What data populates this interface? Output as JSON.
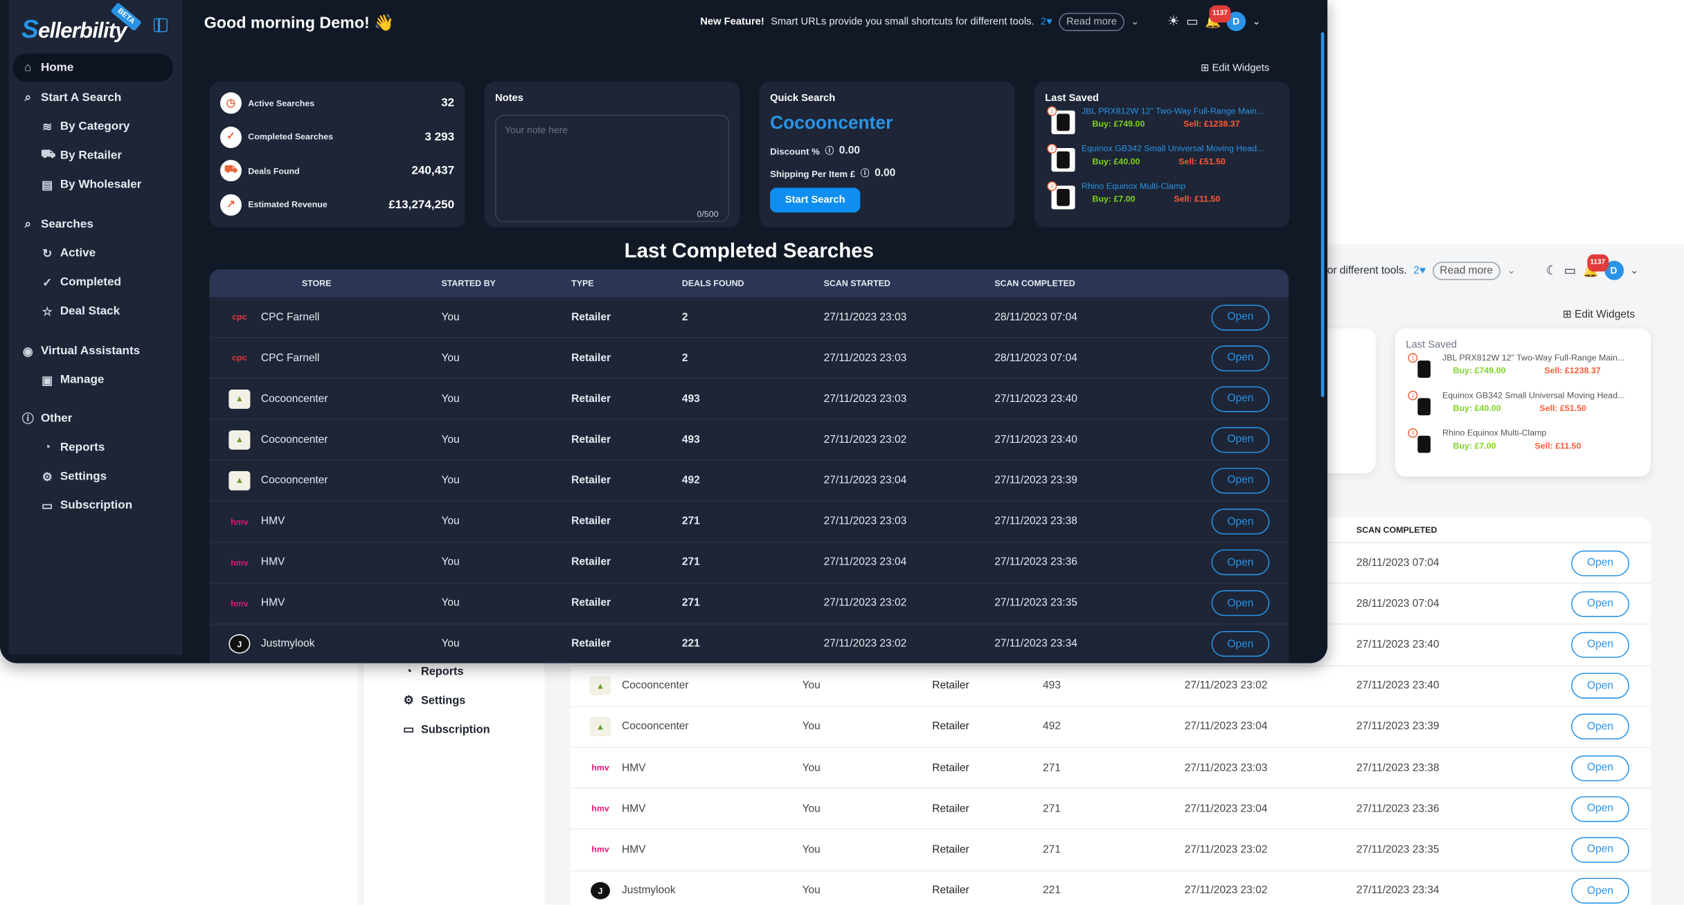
{
  "app": {
    "logo": "ellerbility",
    "logo_first": "S",
    "beta": "BETA",
    "greeting": "Good morning Demo! 👋"
  },
  "topbar": {
    "feature_bold": "New Feature!",
    "feature_text": "Smart URLs provide you small shortcuts for different tools.",
    "feature_text_partial": "for different tools.",
    "likes": "2",
    "read_more": "Read more",
    "notif_count": "1137",
    "avatar": "D"
  },
  "edit_widgets": "Edit Widgets",
  "sidebar": {
    "items": [
      {
        "label": "Home",
        "icon": "home-icon"
      },
      {
        "label": "Start A Search",
        "icon": "search-icon"
      },
      {
        "label": "By Category",
        "icon": "layers-icon"
      },
      {
        "label": "By Retailer",
        "icon": "cart-icon"
      },
      {
        "label": "By Wholesaler",
        "icon": "document-icon"
      },
      {
        "label": "Searches",
        "icon": "search-icon"
      },
      {
        "label": "Active",
        "icon": "refresh-icon"
      },
      {
        "label": "Completed",
        "icon": "check-circle-icon"
      },
      {
        "label": "Deal Stack",
        "icon": "star-icon"
      },
      {
        "label": "Virtual Assistants",
        "icon": "user-circle-icon"
      },
      {
        "label": "Manage",
        "icon": "manage-icon"
      },
      {
        "label": "Other",
        "icon": "info-icon"
      },
      {
        "label": "Reports",
        "icon": "pie-icon"
      },
      {
        "label": "Settings",
        "icon": "gear-icon"
      },
      {
        "label": "Subscription",
        "icon": "card-icon"
      }
    ]
  },
  "stats": [
    {
      "label": "Active Searches",
      "value": "32"
    },
    {
      "label": "Completed Searches",
      "value": "3 293"
    },
    {
      "label": "Deals Found",
      "value": "240,437"
    },
    {
      "label": "Estimated Revenue",
      "value": "£13,274,250"
    }
  ],
  "notes": {
    "title": "Notes",
    "placeholder": "Your note here",
    "count": "0/500"
  },
  "quick_search": {
    "title": "Quick Search",
    "store": "Cocooncenter",
    "discount_label": "Discount %",
    "discount_value": "0.00",
    "shipping_label": "Shipping Per Item £",
    "shipping_value": "0.00",
    "button": "Start Search"
  },
  "last_saved": {
    "title": "Last Saved",
    "items": [
      {
        "title": "JBL PRX812W 12\" Two-Way Full-Range Main...",
        "buy": "Buy: £749.00",
        "sell": "Sell: £1238.37"
      },
      {
        "title": "Equinox GB342 Small Universal Moving Head...",
        "buy": "Buy: £40.00",
        "sell": "Sell: £51.50"
      },
      {
        "title": "Rhino Equinox Multi-Clamp",
        "buy": "Buy: £7.00",
        "sell": "Sell: £11.50"
      }
    ]
  },
  "table": {
    "title": "Last Completed Searches",
    "headers": [
      "STORE",
      "STARTED BY",
      "TYPE",
      "DEALS FOUND",
      "SCAN STARTED",
      "SCAN COMPLETED"
    ],
    "open_label": "Open",
    "rows": [
      {
        "store": "CPC Farnell",
        "by": "You",
        "type": "Retailer",
        "deals": "2",
        "started": "27/11/2023 23:03",
        "completed": "28/11/2023 07:04"
      },
      {
        "store": "CPC Farnell",
        "by": "You",
        "type": "Retailer",
        "deals": "2",
        "started": "27/11/2023 23:03",
        "completed": "28/11/2023 07:04"
      },
      {
        "store": "Cocooncenter",
        "by": "You",
        "type": "Retailer",
        "deals": "493",
        "started": "27/11/2023 23:03",
        "completed": "27/11/2023 23:40"
      },
      {
        "store": "Cocooncenter",
        "by": "You",
        "type": "Retailer",
        "deals": "493",
        "started": "27/11/2023 23:02",
        "completed": "27/11/2023 23:40"
      },
      {
        "store": "Cocooncenter",
        "by": "You",
        "type": "Retailer",
        "deals": "492",
        "started": "27/11/2023 23:04",
        "completed": "27/11/2023 23:39"
      },
      {
        "store": "HMV",
        "by": "You",
        "type": "Retailer",
        "deals": "271",
        "started": "27/11/2023 23:03",
        "completed": "27/11/2023 23:38"
      },
      {
        "store": "HMV",
        "by": "You",
        "type": "Retailer",
        "deals": "271",
        "started": "27/11/2023 23:04",
        "completed": "27/11/2023 23:36"
      },
      {
        "store": "HMV",
        "by": "You",
        "type": "Retailer",
        "deals": "271",
        "started": "27/11/2023 23:02",
        "completed": "27/11/2023 23:35"
      },
      {
        "store": "Justmylook",
        "by": "You",
        "type": "Retailer",
        "deals": "221",
        "started": "27/11/2023 23:02",
        "completed": "27/11/2023 23:34"
      }
    ],
    "light_rows": [
      {
        "store": "",
        "by": "",
        "type": "",
        "deals": "",
        "started": "",
        "completed": "28/11/2023 07:04"
      },
      {
        "store": "",
        "by": "",
        "type": "",
        "deals": "",
        "started": "",
        "completed": "28/11/2023 07:04"
      },
      {
        "store": "",
        "by": "",
        "type": "",
        "deals": "",
        "started": "",
        "completed": "27/11/2023 23:40"
      },
      {
        "store": "Cocooncenter",
        "by": "You",
        "type": "Retailer",
        "deals": "493",
        "started": "27/11/2023 23:02",
        "completed": "27/11/2023 23:40"
      },
      {
        "store": "Cocooncenter",
        "by": "You",
        "type": "Retailer",
        "deals": "492",
        "started": "27/11/2023 23:04",
        "completed": "27/11/2023 23:39"
      },
      {
        "store": "HMV",
        "by": "You",
        "type": "Retailer",
        "deals": "271",
        "started": "27/11/2023 23:03",
        "completed": "27/11/2023 23:38"
      },
      {
        "store": "HMV",
        "by": "You",
        "type": "Retailer",
        "deals": "271",
        "started": "27/11/2023 23:04",
        "completed": "27/11/2023 23:36"
      },
      {
        "store": "HMV",
        "by": "You",
        "type": "Retailer",
        "deals": "271",
        "started": "27/11/2023 23:02",
        "completed": "27/11/2023 23:35"
      },
      {
        "store": "Justmylook",
        "by": "You",
        "type": "Retailer",
        "deals": "221",
        "started": "27/11/2023 23:02",
        "completed": "27/11/2023 23:34"
      }
    ]
  },
  "light_sidebar": [
    {
      "label": "Other",
      "icon": "info-icon"
    },
    {
      "label": "Reports",
      "icon": "pie-icon"
    },
    {
      "label": "Settings",
      "icon": "gear-icon"
    },
    {
      "label": "Subscription",
      "icon": "card-icon"
    }
  ],
  "colors": {
    "accent": "#2a93e6",
    "dark_bg": "#111826",
    "panel": "#1d2536",
    "buy": "#7ed321",
    "sell": "#ff5a36"
  }
}
